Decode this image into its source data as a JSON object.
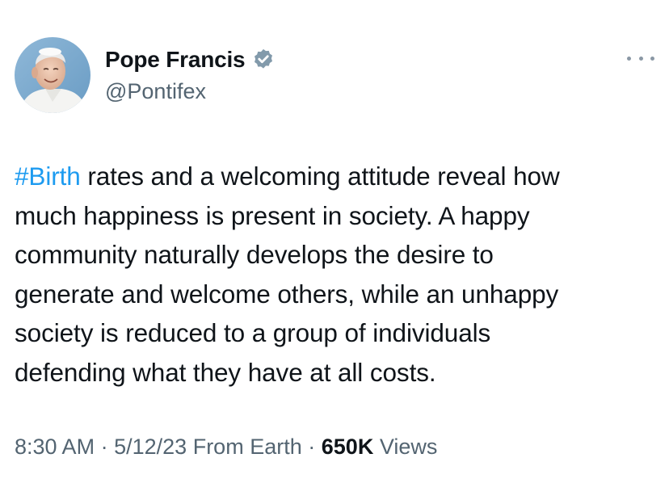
{
  "author": {
    "display_name": "Pope Francis",
    "handle": "@Pontifex",
    "verified": true,
    "avatar_icon": "pope-avatar"
  },
  "tweet": {
    "hashtag": "#Birth",
    "lines": [
      " rates and a welcoming attitude reveal how",
      "much happiness is present in society. A happy",
      "community naturally develops the desire to",
      "generate and welcome others, while an unhappy",
      "society is reduced to a group of individuals",
      "defending what they have at all costs."
    ],
    "time": "8:30 AM",
    "separator": "·",
    "date": "5/12/23",
    "source": "From Earth",
    "views_count": "650K",
    "views_label": "Views"
  },
  "colors": {
    "link": "#1d9bf0",
    "text": "#0f1419",
    "secondary": "#536471",
    "verified_badge": "#829aab"
  }
}
